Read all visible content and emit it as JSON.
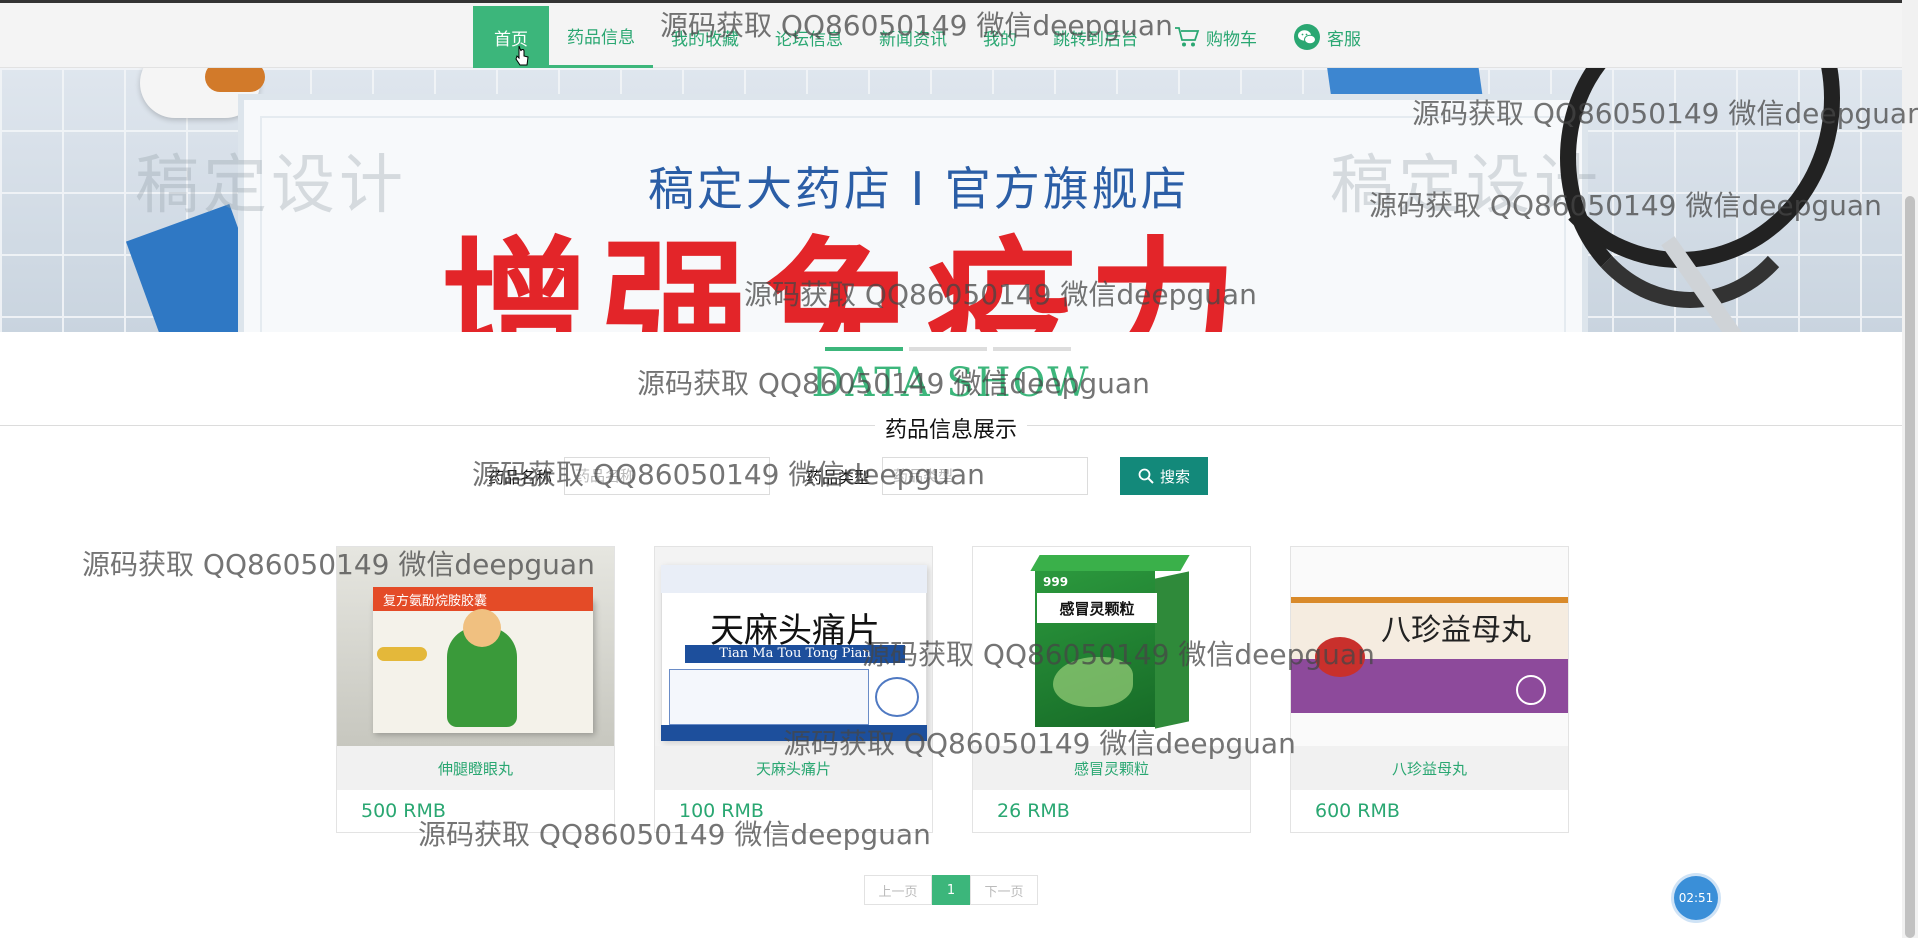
{
  "nav": {
    "items": [
      {
        "label": "首页"
      },
      {
        "label": "药品信息"
      },
      {
        "label": "我的收藏"
      },
      {
        "label": "论坛信息"
      },
      {
        "label": "新闻资讯"
      },
      {
        "label": "我的"
      },
      {
        "label": "跳转到后台"
      },
      {
        "label": "购物车"
      },
      {
        "label": "客服"
      }
    ]
  },
  "banner": {
    "title": "稿定大药店 I 官方旗舰店",
    "headline": "增强免疫力",
    "watermark": "稿定设计"
  },
  "section": {
    "title_en": "DATA SHOW",
    "title_zh": "药品信息展示"
  },
  "search": {
    "name_label": "药品名称",
    "name_placeholder": "药品名称",
    "type_label": "药品类型",
    "type_placeholder": "药品类型",
    "button_label": "搜索"
  },
  "products": [
    {
      "name": "伸腿瞪眼丸",
      "price": "500 RMB",
      "box_text": "复方氨酚烷胺胶囊"
    },
    {
      "name": "天麻头痛片",
      "price": "100 RMB",
      "box_text": "天麻头痛片",
      "box_subtext": "Tian Ma Tou Tong Pian"
    },
    {
      "name": "感冒灵颗粒",
      "price": "26 RMB",
      "box_text": "感冒灵颗粒",
      "box_brand": "999"
    },
    {
      "name": "八珍益母丸",
      "price": "600 RMB",
      "box_text": "八珍益母丸"
    }
  ],
  "pagination": {
    "prev": "上一页",
    "current": "1",
    "next": "下一页"
  },
  "timer": "02:51",
  "watermark_text": "源码获取 QQ86050149 微信deepguan",
  "colors": {
    "accent": "#3cb67b",
    "search_button": "#13897a",
    "timer": "#3a8fd8"
  }
}
